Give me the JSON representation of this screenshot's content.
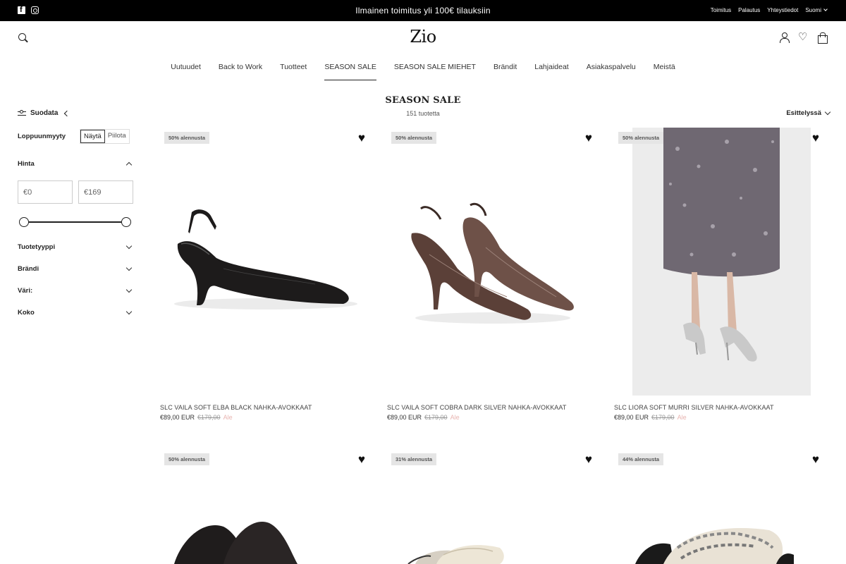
{
  "topbar": {
    "announcement": "Ilmainen toimitus yli 100€ tilauksiin",
    "links": [
      "Toimitus",
      "Palautus",
      "Yhteystiedot"
    ],
    "language": "Suomi",
    "social_icons": [
      "facebook-icon",
      "instagram-icon"
    ]
  },
  "header": {
    "logo": "Zio",
    "icons": [
      "search-icon",
      "account-icon",
      "wishlist-icon",
      "cart-icon"
    ]
  },
  "nav": {
    "items": [
      "Uutuudet",
      "Back to Work",
      "Tuotteet",
      "SEASON SALE",
      "SEASON SALE MIEHET",
      "Brändit",
      "Lahjaideat",
      "Asiakaspalvelu",
      "Meistä"
    ],
    "active": "SEASON SALE"
  },
  "sidebar": {
    "filter_toggle": "Suodata",
    "sold_out": {
      "label": "Loppuunmyyty",
      "show": "Näytä",
      "hide": "Piilota",
      "selected": "Näytä"
    },
    "price": {
      "label": "Hinta",
      "min_value": "€0",
      "max_value": "€169",
      "range_fraction": [
        0,
        1
      ]
    },
    "facets": [
      "Tuotetyyppi",
      "Brändi",
      "Väri:",
      "Koko"
    ]
  },
  "collection": {
    "title": "SEASON SALE",
    "count": "151 tuotetta",
    "sort_label": "Esittelyssä"
  },
  "products": [
    {
      "badge": "50% alennusta",
      "title": "SLC VAILA SOFT ELBA BLACK NAHKA-AVOKKAAT",
      "price": "€89,00 EUR",
      "was": "€179,00",
      "sale_label": "Ale"
    },
    {
      "badge": "50% alennusta",
      "title": "SLC VAILA SOFT COBRA DARK SILVER NAHKA-AVOKKAAT",
      "price": "€89,00 EUR",
      "was": "€179,00",
      "sale_label": "Ale"
    },
    {
      "badge": "50% alennusta",
      "title": "SLC LIORA SOFT MURRI SILVER NAHKA-AVOKKAAT",
      "price": "€89,00 EUR",
      "was": "€179,00",
      "sale_label": "Ale"
    },
    {
      "badge": "50% alennusta"
    },
    {
      "badge": "31% alennusta"
    },
    {
      "badge": "44% alennusta"
    }
  ],
  "colors": {
    "topbar_bg": "#000000",
    "badge_bg": "#e5e5e5",
    "sale_text": "#e8b4b0"
  }
}
